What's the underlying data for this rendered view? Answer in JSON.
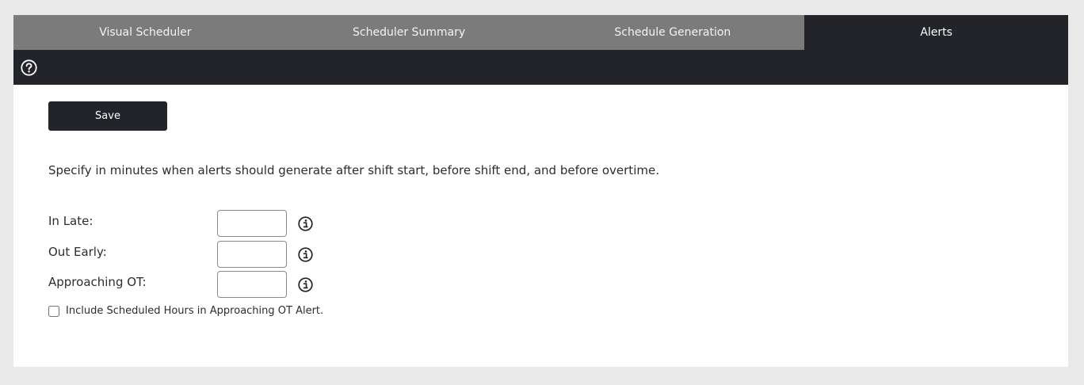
{
  "tabs": [
    {
      "label": "Visual Scheduler",
      "active": false
    },
    {
      "label": "Scheduler Summary",
      "active": false
    },
    {
      "label": "Schedule Generation",
      "active": false
    },
    {
      "label": "Alerts",
      "active": true
    }
  ],
  "toolbar": {
    "help_icon": "question-circle-icon"
  },
  "actions": {
    "save_label": "Save"
  },
  "instructions": "Specify in minutes when alerts should generate after shift start, before shift end, and before overtime.",
  "fields": [
    {
      "label": "In Late:",
      "value": "",
      "info_icon": "info-icon"
    },
    {
      "label": "Out Early:",
      "value": "",
      "info_icon": "info-icon"
    },
    {
      "label": "Approaching OT:",
      "value": "",
      "info_icon": "info-icon"
    }
  ],
  "include_scheduled": {
    "label": "Include Scheduled Hours in Approaching OT Alert.",
    "checked": false
  },
  "colors": {
    "tab_bar": "#7b7b7b",
    "active_tab": "#222429",
    "toolbar": "#222429",
    "page_background": "#e9e9e9"
  }
}
